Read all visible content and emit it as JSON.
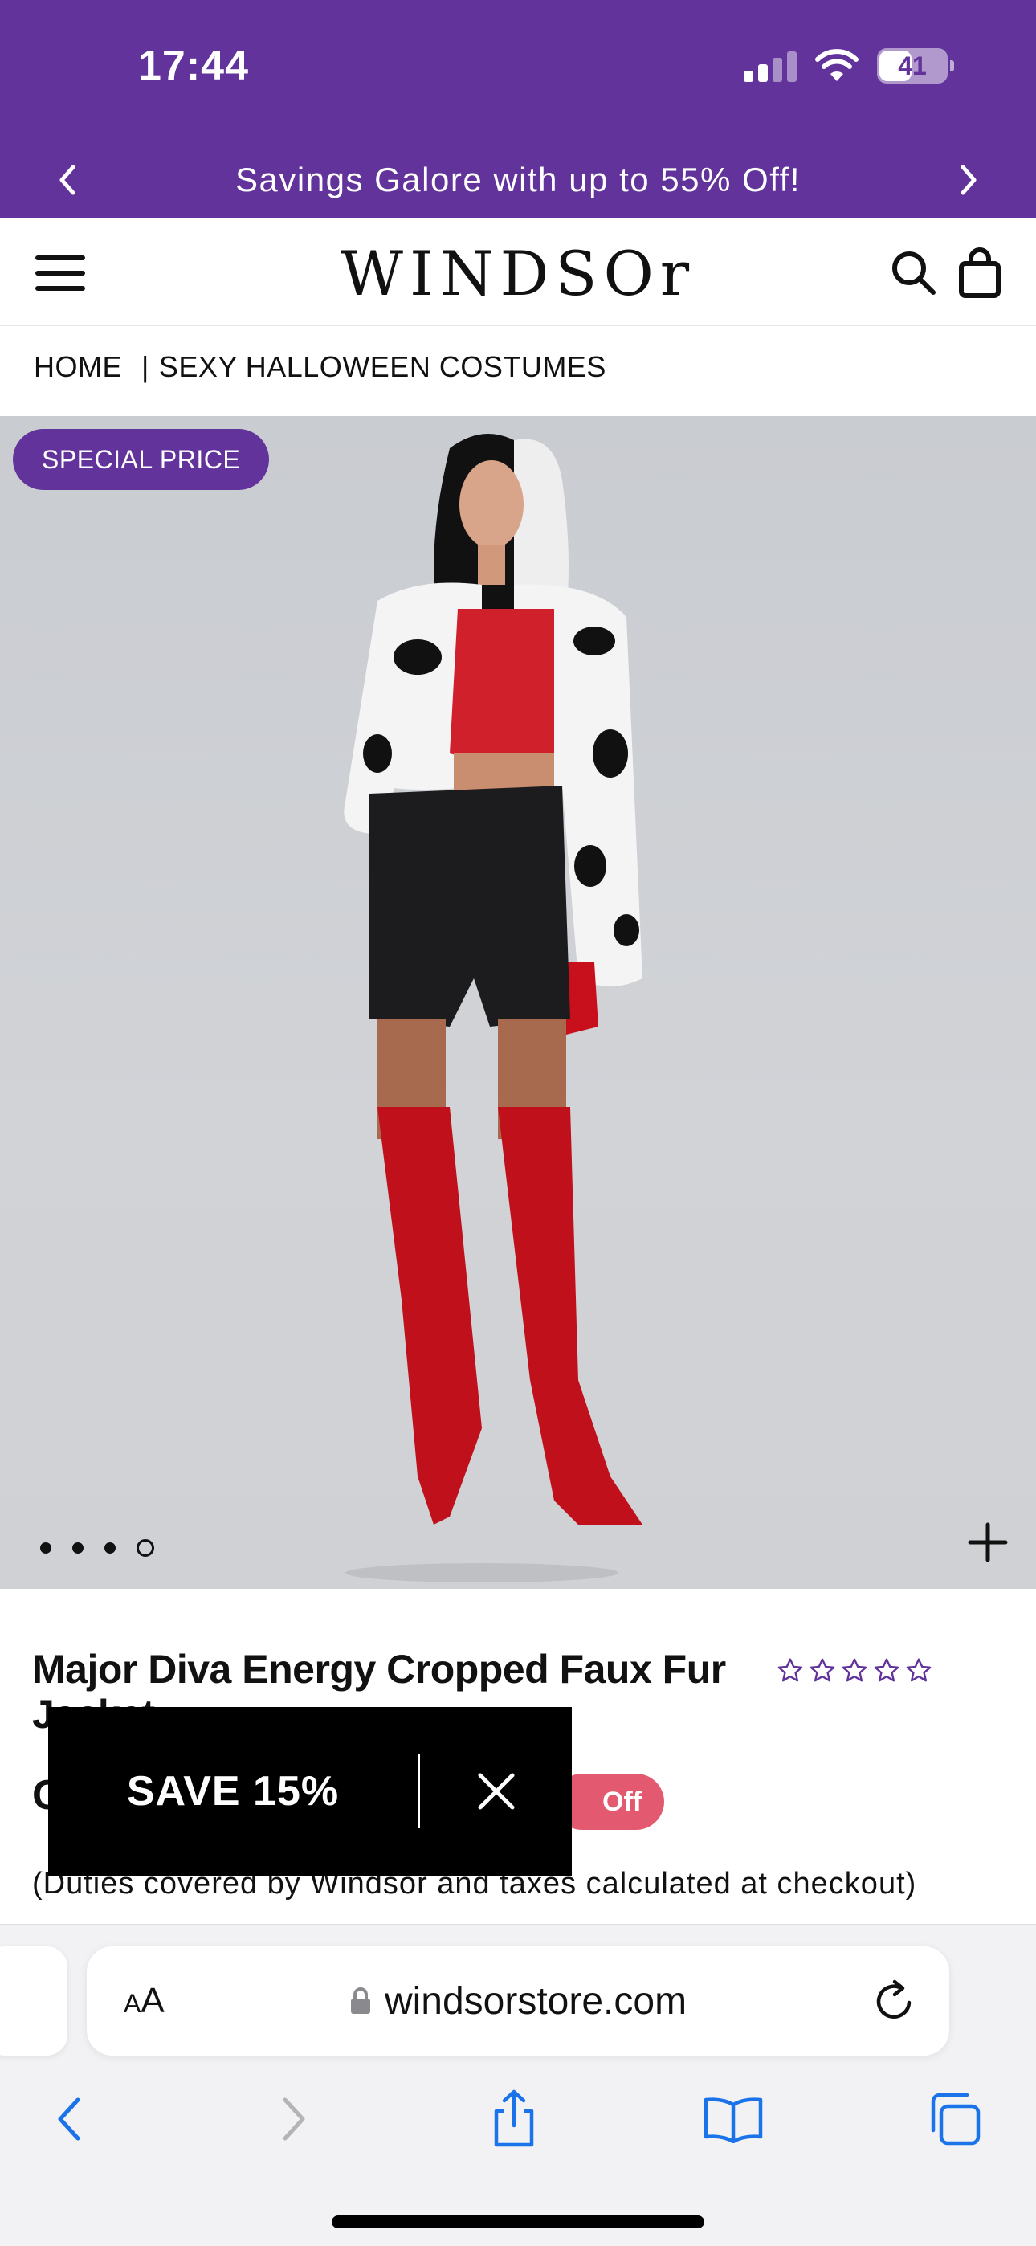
{
  "status_bar": {
    "time": "17:44",
    "battery": "41"
  },
  "promo": {
    "text": "Savings Galore with up to 55% Off!"
  },
  "header": {
    "logo": "WINDSOr"
  },
  "breadcrumb": {
    "home": "HOME",
    "separator": "|",
    "category": "SEXY HALLOWEEN COSTUMES"
  },
  "product": {
    "badge": "SPECIAL PRICE",
    "title": "Major Diva Energy Cropped Faux Fur Jacket",
    "price_partial": "C",
    "discount_label": "Off",
    "duties_note": "(Duties covered by Windsor and taxes calculated at checkout)",
    "rating_stars": 5,
    "gallery_count": 4,
    "gallery_active_index": 3
  },
  "popup": {
    "save_label": "SAVE 15%"
  },
  "browser": {
    "aa_label": "AA",
    "url": "windsorstore.com"
  },
  "colors": {
    "brand_purple": "#62339a",
    "discount_pink": "#e35a70",
    "safari_blue": "#1a73e8"
  },
  "icons": {
    "menu": "hamburger-icon",
    "search": "search-icon",
    "bag": "shopping-bag-icon",
    "zoom": "plus-icon",
    "close": "close-icon",
    "lock": "lock-icon",
    "reload": "reload-icon",
    "back": "chevron-left-icon",
    "forward": "chevron-right-icon",
    "share": "share-icon",
    "bookmarks": "book-icon",
    "tabs": "tabs-icon"
  }
}
